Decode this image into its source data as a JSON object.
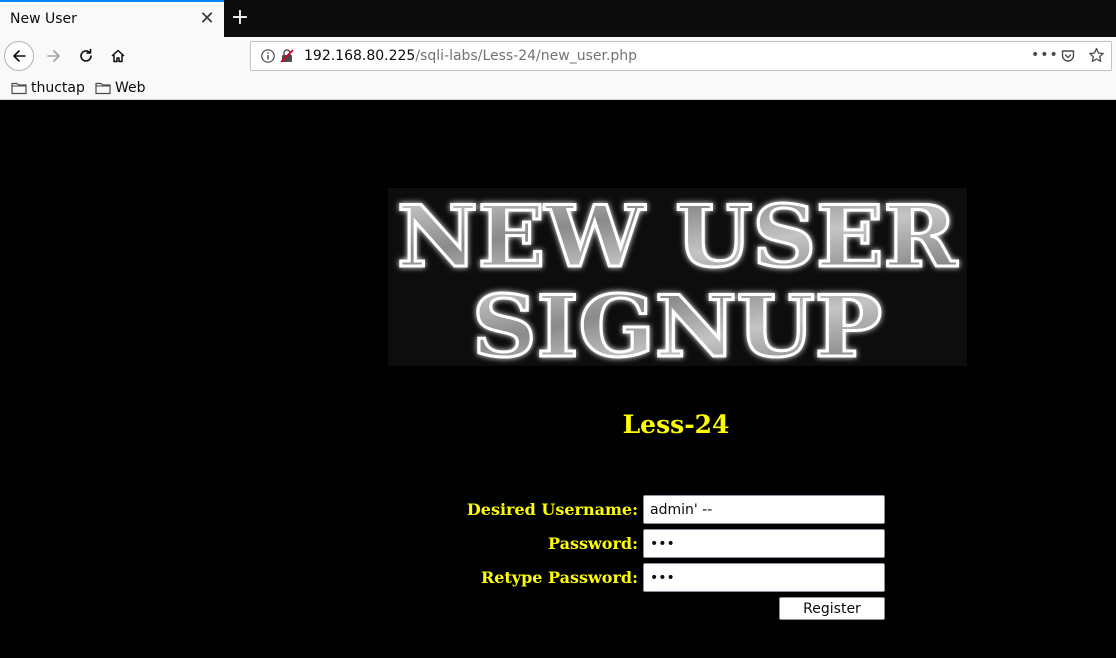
{
  "browser": {
    "tab_title": "New User",
    "tab_close_glyph": "✕",
    "new_tab_glyph": "+",
    "url_host": "192.168.80.225",
    "url_path": "/sqli-labs/Less-24/new_user.php",
    "page_actions_glyph": "•••",
    "bookmarks": [
      {
        "label": "thuctap",
        "icon": "folder-icon"
      },
      {
        "label": "Web",
        "icon": "folder-icon"
      }
    ],
    "accent_color": "#0a84ff"
  },
  "page": {
    "banner": {
      "line1": "NEW USER",
      "line2": "SIGNUP"
    },
    "lesson_title": "Less-24",
    "title_color": "#ffff00",
    "form": {
      "username_label": "Desired Username:",
      "username_value": "admin' --",
      "password_label": "Password:",
      "password_value": "•••",
      "retype_label": "Retype Password:",
      "retype_value": "•••",
      "register_label": "Register"
    }
  }
}
